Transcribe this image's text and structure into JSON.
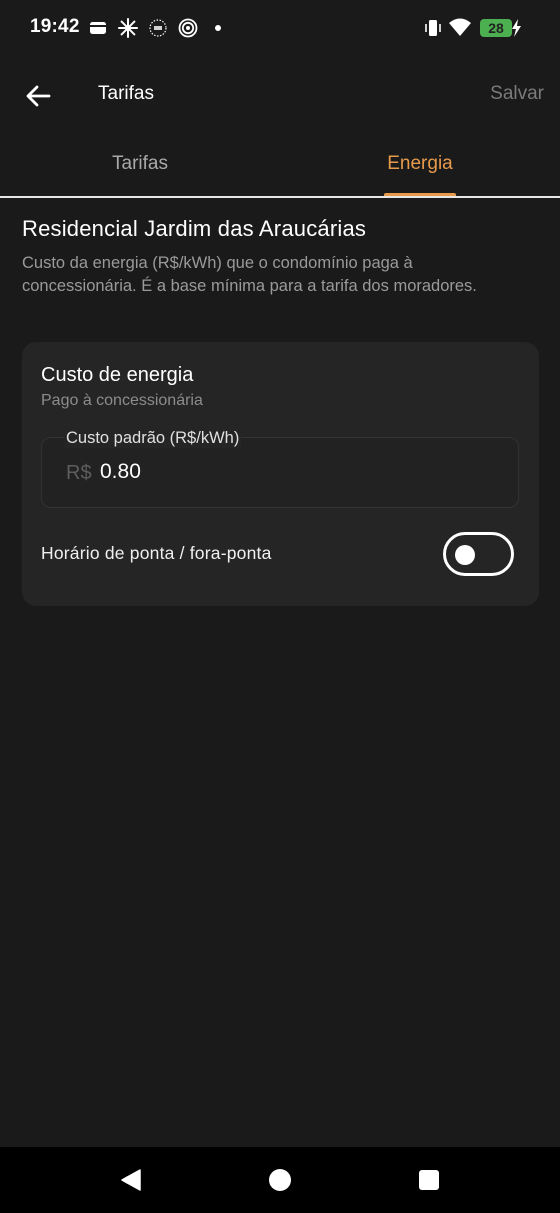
{
  "status_bar": {
    "time": "19:42",
    "battery_level": "28",
    "icons": [
      "wallet-icon",
      "pinwheel-icon",
      "nfc-dots-icon",
      "spiral-icon",
      "dot-icon",
      "vibrate-icon",
      "wifi-icon",
      "battery-icon",
      "charging-bolt-icon"
    ]
  },
  "app_bar": {
    "title": "Tarifas",
    "save_label": "Salvar",
    "back_icon": "arrow-left-icon"
  },
  "tabs": [
    {
      "label": "Tarifas",
      "active": false
    },
    {
      "label": "Energia",
      "active": true
    }
  ],
  "content": {
    "condo_name": "Residencial Jardim das Araucárias",
    "description": "Custo da energia (R$/kWh) que o condomínio paga à concessionária. É a base mínima para a tarifa dos moradores."
  },
  "card": {
    "title": "Custo de energia",
    "subtitle": "Pago à concessionária",
    "field": {
      "label": "Custo padrão (R$/kWh)",
      "prefix": "R$",
      "value": "0.80"
    },
    "toggle": {
      "label": "Horário de ponta / fora-ponta",
      "on": false
    }
  },
  "colors": {
    "background": "#1a1a1a",
    "card": "#252525",
    "accent": "#e79a4c",
    "muted_text": "#9a9a9a",
    "battery": "#4caf50"
  },
  "nav_bar": {
    "icons": [
      "back-triangle-icon",
      "home-circle-icon",
      "recents-square-icon"
    ]
  }
}
